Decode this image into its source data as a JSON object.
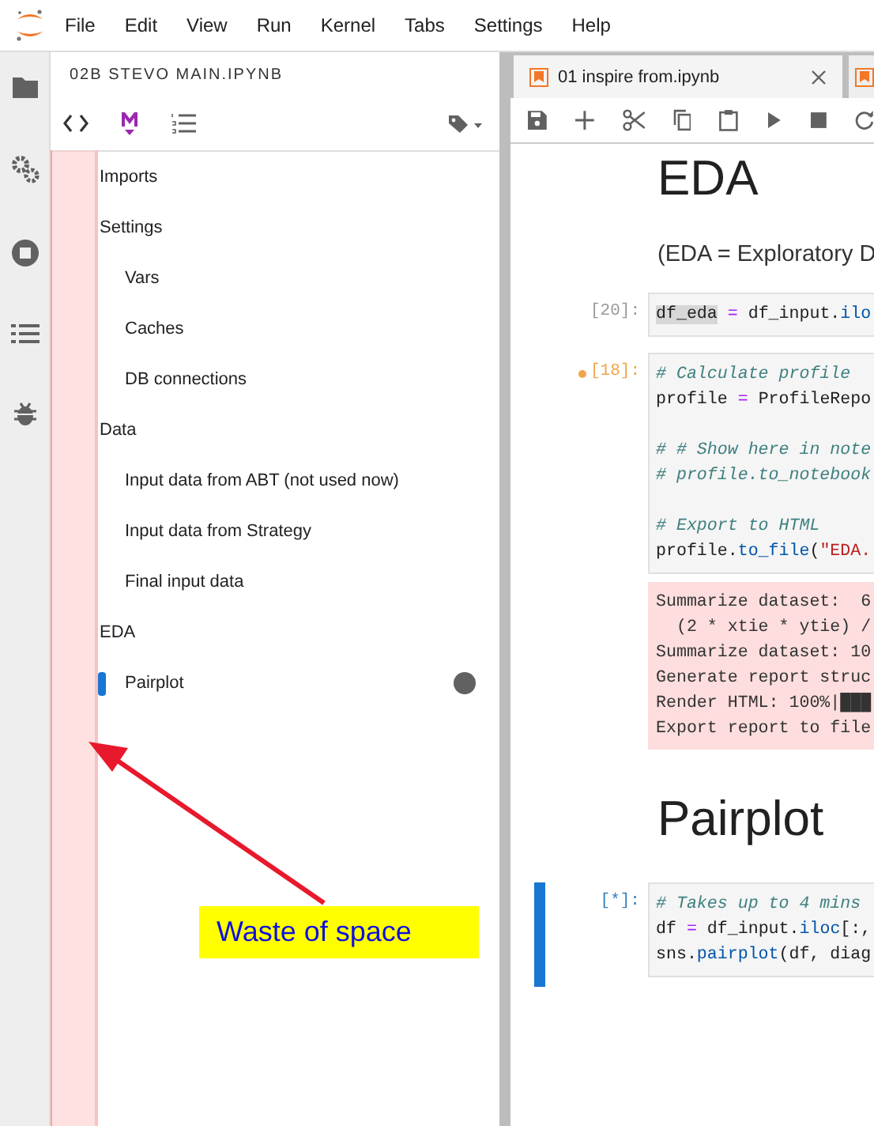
{
  "menu": [
    "File",
    "Edit",
    "View",
    "Run",
    "Kernel",
    "Tabs",
    "Settings",
    "Help"
  ],
  "toc_panel": {
    "title": "02B STEVO MAIN.IPYNB",
    "items": [
      {
        "label": "Imports",
        "running": false
      },
      {
        "label": "Settings",
        "running": false,
        "children": [
          {
            "label": "Vars",
            "running": false
          },
          {
            "label": "Caches",
            "running": false
          },
          {
            "label": "DB connections",
            "running": false
          }
        ]
      },
      {
        "label": "Data",
        "running": false,
        "children": [
          {
            "label": "Input data from ABT (not used now)",
            "running": false
          },
          {
            "label": "Input data from Strategy",
            "running": false
          },
          {
            "label": "Final input data",
            "running": false
          }
        ]
      },
      {
        "label": "EDA",
        "running": false,
        "children": [
          {
            "label": "Pairplot",
            "running": true
          }
        ]
      }
    ]
  },
  "tabs": [
    {
      "label": "01 inspire from.ipynb",
      "selected": true
    }
  ],
  "cells": [
    {
      "kind": "heading",
      "text": "EDA"
    },
    {
      "kind": "markdown",
      "text": "(EDA = Exploratory D"
    },
    {
      "kind": "code",
      "prompt": "[20]:",
      "modified": false,
      "selected": false,
      "blocks": [
        [
          [
            {
              "text": "df_eda",
              "kind": "selection"
            },
            {
              "text": " = ",
              "kind": "operator"
            },
            {
              "text": "df_input.",
              "kind": "plain"
            },
            {
              "text": "ilo",
              "kind": "function"
            }
          ]
        ]
      ]
    },
    {
      "kind": "code",
      "prompt": "[18]:",
      "modified": true,
      "selected": false,
      "blocks": [
        [
          [
            {
              "text": "# Calculate profile",
              "kind": "comment"
            }
          ],
          [
            {
              "text": "profile",
              "kind": "plain"
            },
            {
              "text": " = ",
              "kind": "operator"
            },
            {
              "text": "ProfileRepo",
              "kind": "plain"
            }
          ]
        ],
        [
          [
            {
              "text": "# # Show here in note",
              "kind": "comment"
            }
          ],
          [
            {
              "text": "# profile.to_notebook",
              "kind": "comment"
            }
          ]
        ],
        [
          [
            {
              "text": "# Export to HTML",
              "kind": "comment"
            }
          ],
          [
            {
              "text": "profile.",
              "kind": "plain"
            },
            {
              "text": "to_file",
              "kind": "function"
            },
            {
              "text": "(",
              "kind": "plain"
            },
            {
              "text": "\"EDA.",
              "kind": "string"
            }
          ]
        ]
      ]
    },
    {
      "kind": "output",
      "lines": [
        "Summarize dataset:  6",
        "  (2 * xtie * ytie) /",
        "Summarize dataset: 10",
        "Generate report struc",
        "Render HTML: 100%|███",
        "Export report to file"
      ]
    },
    {
      "kind": "heading",
      "text": "Pairplot"
    },
    {
      "kind": "code",
      "prompt": "[*]:",
      "modified": false,
      "selected": true,
      "blocks": [
        [
          [
            {
              "text": "# Takes up to 4 mins",
              "kind": "comment"
            }
          ],
          [
            {
              "text": "df",
              "kind": "plain"
            },
            {
              "text": " = ",
              "kind": "operator"
            },
            {
              "text": "df_input.",
              "kind": "plain"
            },
            {
              "text": "iloc",
              "kind": "function"
            },
            {
              "text": "[:,",
              "kind": "plain"
            }
          ],
          [
            {
              "text": "sns.",
              "kind": "plain"
            },
            {
              "text": "pairplot",
              "kind": "function"
            },
            {
              "text": "(df, diag",
              "kind": "plain"
            }
          ]
        ]
      ]
    }
  ],
  "annotation": {
    "text": "Waste of space"
  }
}
